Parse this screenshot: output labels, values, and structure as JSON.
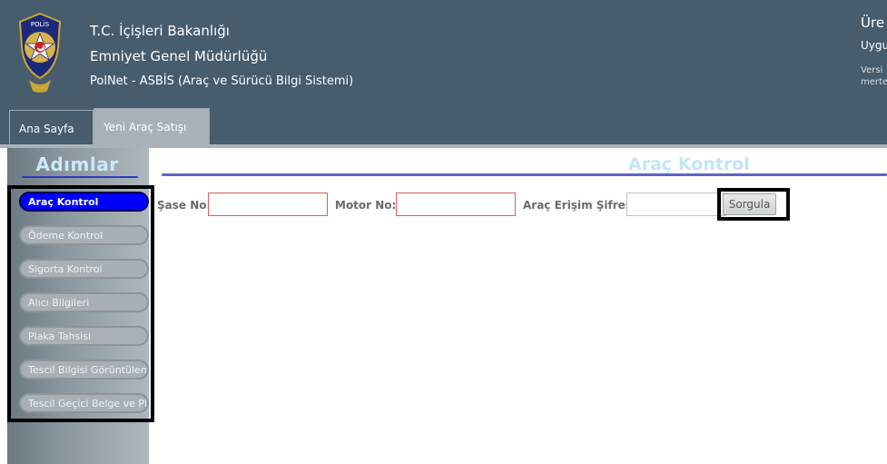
{
  "header": {
    "ministry": "T.C. İçişleri Bakanlığı",
    "directorate": "Emniyet Genel Müdürlüğü",
    "system": "PolNet - ASBİS (Araç ve Sürücü Bilgi Sistemi)",
    "right_line1": "Üre",
    "right_line2": "Uygu",
    "right_line3": "Versi",
    "right_line4": "merte",
    "logo_text": "POLİS",
    "colors": {
      "header_bg": "#475c6d"
    }
  },
  "tabs": [
    {
      "label": "Ana Sayfa",
      "active": false
    },
    {
      "label": "Yeni Araç Satışı",
      "active": true
    }
  ],
  "sidebar": {
    "title": "Adımlar",
    "steps": [
      {
        "label": "Araç Kontrol",
        "active": true
      },
      {
        "label": "Ödeme Kontrol",
        "active": false
      },
      {
        "label": "Sigorta Kontrol",
        "active": false
      },
      {
        "label": "Alıcı Bilgileri",
        "active": false
      },
      {
        "label": "Plaka Tahsisi",
        "active": false
      },
      {
        "label": "Tescil Bilgisi Görüntüleme",
        "active": false
      },
      {
        "label": "Tescil Geçici Belge ve Pla",
        "active": false
      }
    ]
  },
  "content": {
    "title": "Araç Kontrol",
    "form": {
      "sase_label": "Şase No:",
      "sase_value": "",
      "motor_label": "Motor No:",
      "motor_value": "",
      "erisim_label": "Araç Erişim Şifresi:",
      "erisim_value": "",
      "submit_label": "Sorgula"
    }
  }
}
